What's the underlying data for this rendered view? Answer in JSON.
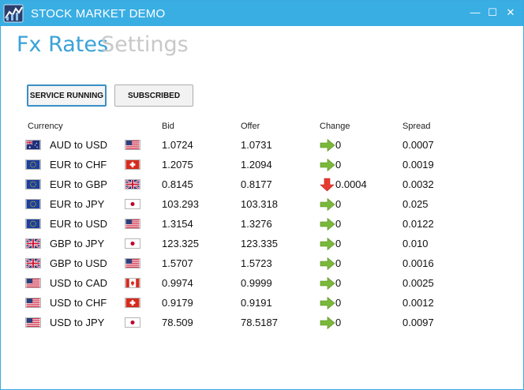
{
  "window": {
    "title": "STOCK MARKET DEMO",
    "controls": {
      "minimize": "—",
      "maximize": "☐",
      "close": "✕"
    }
  },
  "nav": {
    "active": "Fx Rates",
    "inactive": "Settings"
  },
  "buttons": {
    "service": "SERVICE RUNNING",
    "subscribed": "SUBSCRIBED"
  },
  "columns": [
    "Currency",
    "Bid",
    "Offer",
    "Change",
    "Spread"
  ],
  "colors": {
    "titlebar": "#39aee3",
    "active_nav": "#3aa2d8",
    "up": "#7ab83a",
    "down": "#e83b2f"
  },
  "rows": [
    {
      "pair": "AUD to USD",
      "from": "AU",
      "to": "US",
      "bid": "1.0724",
      "offer": "1.0731",
      "change": "0",
      "dir": "up",
      "spread": "0.0007"
    },
    {
      "pair": "EUR to CHF",
      "from": "EU",
      "to": "CH",
      "bid": "1.2075",
      "offer": "1.2094",
      "change": "0",
      "dir": "up",
      "spread": "0.0019"
    },
    {
      "pair": "EUR to GBP",
      "from": "EU",
      "to": "GB",
      "bid": "0.8145",
      "offer": "0.8177",
      "change": "0.0004",
      "dir": "down",
      "spread": "0.0032"
    },
    {
      "pair": "EUR to JPY",
      "from": "EU",
      "to": "JP",
      "bid": "103.293",
      "offer": "103.318",
      "change": "0",
      "dir": "up",
      "spread": "0.025"
    },
    {
      "pair": "EUR to USD",
      "from": "EU",
      "to": "US",
      "bid": "1.3154",
      "offer": "1.3276",
      "change": "0",
      "dir": "up",
      "spread": "0.0122"
    },
    {
      "pair": "GBP to JPY",
      "from": "GB",
      "to": "JP",
      "bid": "123.325",
      "offer": "123.335",
      "change": "0",
      "dir": "up",
      "spread": "0.010"
    },
    {
      "pair": "GBP to USD",
      "from": "GB",
      "to": "US",
      "bid": "1.5707",
      "offer": "1.5723",
      "change": "0",
      "dir": "up",
      "spread": "0.0016"
    },
    {
      "pair": "USD to CAD",
      "from": "US",
      "to": "CA",
      "bid": "0.9974",
      "offer": "0.9999",
      "change": "0",
      "dir": "up",
      "spread": "0.0025"
    },
    {
      "pair": "USD to CHF",
      "from": "US",
      "to": "CH",
      "bid": "0.9179",
      "offer": "0.9191",
      "change": "0",
      "dir": "up",
      "spread": "0.0012"
    },
    {
      "pair": "USD to JPY",
      "from": "US",
      "to": "JP",
      "bid": "78.509",
      "offer": "78.5187",
      "change": "0",
      "dir": "up",
      "spread": "0.0097"
    }
  ]
}
